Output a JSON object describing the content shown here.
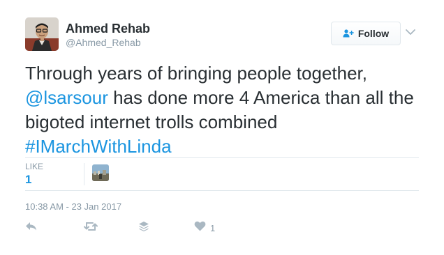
{
  "user": {
    "display_name": "Ahmed Rehab",
    "handle": "@Ahmed_Rehab"
  },
  "follow_button": {
    "label": "Follow",
    "icon": "add-user-icon"
  },
  "tweet": {
    "line1": "Through years of bringing people together,",
    "mention": "@lsarsour",
    "line2_rest": " has done more 4 America than all the",
    "line3": "bigoted internet trolls combined",
    "hashtag": "#IMarchWithLinda"
  },
  "stats": {
    "likes_label": "LIKE",
    "likes_count": "1"
  },
  "timestamp": "10:38 AM - 23 Jan 2017",
  "actions": {
    "reply_icon": "reply-icon",
    "retweet_icon": "retweet-icon",
    "buffer_icon": "buffer-icon",
    "like_icon": "heart-icon",
    "like_count": "1"
  },
  "colors": {
    "link": "#1b95e0",
    "text": "#292f33",
    "muted": "#8899a6",
    "border": "#e1e8ed",
    "icon": "#aab8c2"
  }
}
